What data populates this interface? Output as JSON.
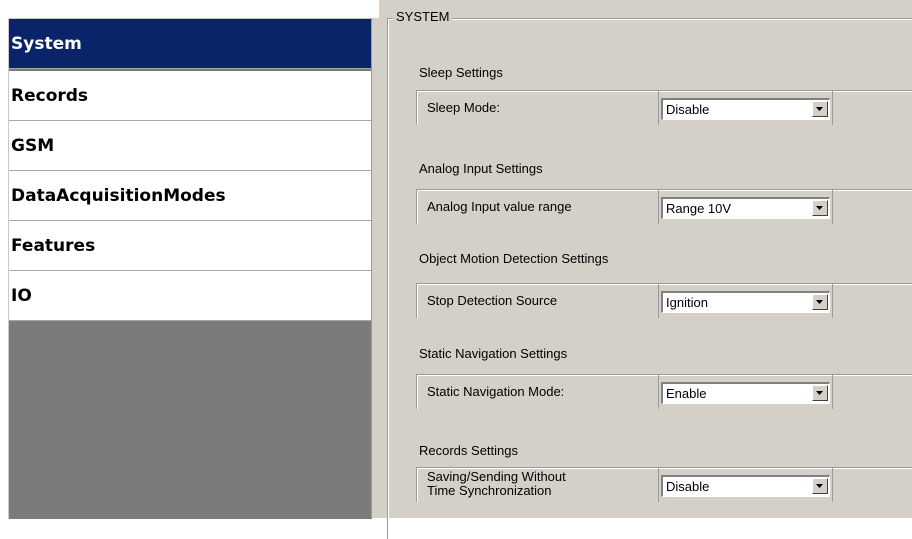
{
  "nav": {
    "items": [
      {
        "label": "System",
        "active": true
      },
      {
        "label": "Records",
        "active": false
      },
      {
        "label": "GSM",
        "active": false
      },
      {
        "label": "DataAcquisitionModes",
        "active": false
      },
      {
        "label": "Features",
        "active": false
      },
      {
        "label": "IO",
        "active": false
      }
    ]
  },
  "panel": {
    "group_title": "SYSTEM",
    "sections": [
      {
        "title": "Sleep Settings",
        "label": "Sleep Mode:",
        "value": "Disable"
      },
      {
        "title": "Analog Input Settings",
        "label": "Analog Input value range",
        "value": "Range 10V"
      },
      {
        "title": "Object Motion Detection Settings",
        "label": "Stop Detection Source",
        "value": "Ignition"
      },
      {
        "title": "Static Navigation Settings",
        "label": "Static Navigation Mode:",
        "value": "Enable"
      },
      {
        "title": "Records Settings",
        "label": "Saving/Sending Without Time Synchronization",
        "value": "Disable"
      }
    ]
  },
  "colors": {
    "nav_active_bg": "#0a246a",
    "panel_bg": "#d4d0c8",
    "nav_empty_bg": "#7b7b7b"
  },
  "icons": {
    "dropdown": "chevron-down-icon"
  }
}
